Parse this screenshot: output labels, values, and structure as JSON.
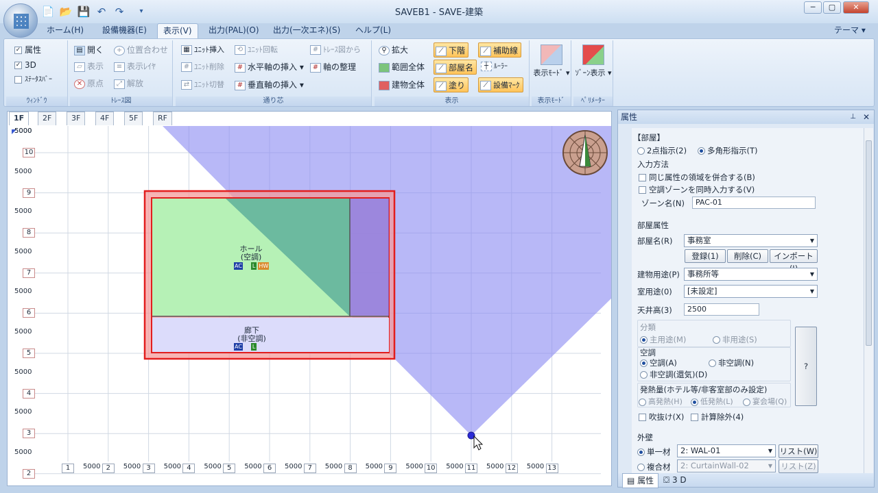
{
  "window": {
    "title": "SAVEB1 - SAVE-建築",
    "minimize": "─",
    "maximize": "▢",
    "close": "✕"
  },
  "quick_access": [
    "📄",
    "📂",
    "💾",
    "↶",
    "↷",
    "▾"
  ],
  "ribbon_tabs": [
    "ホーム(H)",
    "設備機器(E)",
    "表示(V)",
    "出力(PAL)(O)",
    "出力(一次エネ)(S)",
    "ヘルプ(L)"
  ],
  "theme_label": "テーマ ▾",
  "ribbon": {
    "window_group": {
      "label": "ｳｨﾝﾄﾞｳ",
      "attr": "属性",
      "threed": "3D",
      "statusbar": "ｽﾃｰﾀｽﾊﾞｰ"
    },
    "trace_group": {
      "label": "ﾄﾚｰｽ図",
      "open": "開く",
      "align": "位置合わせ",
      "show": "表示",
      "show_layer": "表示ﾚｲﾔ",
      "origin": "原点",
      "release": "解放"
    },
    "grid_group": {
      "label": "通り芯",
      "unit_insert": "ﾕﾆｯﾄ挿入",
      "unit_rotate": "ﾕﾆｯﾄ回転",
      "from_trace": "ﾄﾚｰｽ図から",
      "unit_delete": "ﾕﾆｯﾄ削除",
      "h_axis": "水平軸の挿入 ▾",
      "axis_arrange": "軸の整理",
      "unit_switch": "ﾕﾆｯﾄ切替",
      "v_axis": "垂直軸の挿入 ▾"
    },
    "view_group": {
      "label": "表示",
      "zoom": "拡大",
      "range_all": "範囲全体",
      "building_all": "建物全体",
      "lower": "下階",
      "room_name": "部屋名",
      "paint": "塗り",
      "aux_line": "補助線",
      "ruler": "ﾙｰﾗｰ",
      "equip_mark": "設備ﾏｰｸ"
    },
    "mode_group": {
      "label": "表示ﾓｰﾄﾞ",
      "btn": "表示ﾓｰﾄﾞ ▾"
    },
    "param_group": {
      "label": "ﾍﾟﾘﾒｰﾀｰ",
      "btn": "ｿﾞｰﾝ表示 ▾"
    }
  },
  "floor_tabs": [
    "1F",
    "2F",
    "3F",
    "4F",
    "5F",
    "RF"
  ],
  "grid": {
    "row_labels": [
      "10",
      "9",
      "8",
      "7",
      "6",
      "5",
      "4",
      "3",
      "2"
    ],
    "col_labels": [
      "1",
      "2",
      "3",
      "4",
      "5",
      "6",
      "7",
      "8",
      "9",
      "10",
      "11",
      "12",
      "13"
    ],
    "span": "5000"
  },
  "rooms": [
    {
      "name": "ホール",
      "type": "(空調)",
      "badges": [
        "AC",
        "L",
        "HW"
      ]
    },
    {
      "name": "廊下",
      "type": "(非空調)",
      "badges": [
        "AC",
        "L"
      ]
    }
  ],
  "panel": {
    "title": "属性",
    "section_room": "【部屋】",
    "opt_two_point": "2点指示(2)",
    "opt_polygon": "多角形指示(T)",
    "input_method": "入力方法",
    "chk_merge": "同じ属性の領域を併合する(B)",
    "chk_zone": "空調ゾーンを同時入力する(V)",
    "zone_label": "ゾーン名(N)",
    "zone_value": "PAC-01",
    "room_attr": "部屋属性",
    "room_name_label": "部屋名(R)",
    "room_name_value": "事務室",
    "btn_register": "登録(1)",
    "btn_delete": "削除(C)",
    "btn_import": "インポート(I)",
    "bldg_use_label": "建物用途(P)",
    "bldg_use_value": "事務所等",
    "room_use_label": "室用途(0)",
    "room_use_value": "[未設定]",
    "ceiling_label": "天井高(3)",
    "ceiling_value": "2500",
    "class_label": "分類",
    "class_main": "主用途(M)",
    "class_non": "非用途(S)",
    "ac_label": "空調",
    "ac_on": "空調(A)",
    "ac_off": "非空調(N)",
    "ac_vent": "非空調(還気)(D)",
    "heat_label": "発熱量(ホテル等/非客室部のみ設定)",
    "heat_high": "高発熱(H)",
    "heat_low": "低発熱(L)",
    "heat_banquet": "宴会場(Q)",
    "help": "?",
    "chk_void": "吹抜け(X)",
    "chk_exclude": "計算除外(4)",
    "wall_label": "外壁",
    "wall_single": "単一材",
    "wall_single_value": "2: WAL-01",
    "wall_list": "リスト(W)",
    "wall_multi": "複合材",
    "wall_multi_value": "2: CurtainWall-02",
    "wall_list2": "リスト(Z)",
    "foot_attr": "属性",
    "foot_3d": "3 D"
  }
}
